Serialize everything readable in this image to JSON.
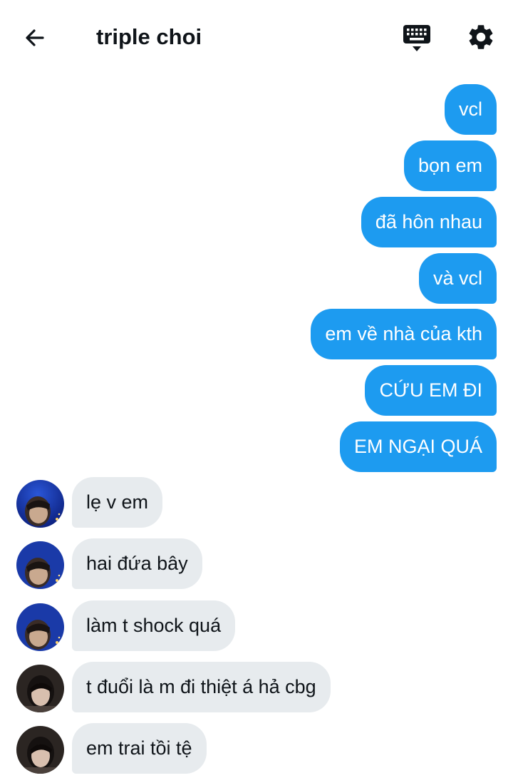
{
  "header": {
    "title": "triple choi",
    "back_icon": "arrow-left-icon",
    "keyboard_icon": "keyboard-icon",
    "settings_icon": "gear-icon"
  },
  "colors": {
    "sent_bubble": "#1d9bf0",
    "received_bubble": "#e7ebee",
    "text": "#0f1419"
  },
  "messages": [
    {
      "direction": "sent",
      "text": "vcl"
    },
    {
      "direction": "sent",
      "text": "bọn em"
    },
    {
      "direction": "sent",
      "text": "đã hôn nhau"
    },
    {
      "direction": "sent",
      "text": "và vcl"
    },
    {
      "direction": "sent",
      "text": "em về nhà của kth"
    },
    {
      "direction": "sent",
      "text": "CỨU EM ĐI"
    },
    {
      "direction": "sent",
      "text": "EM NGẠI QUÁ"
    },
    {
      "direction": "received",
      "text": "lẹ v em",
      "avatar": "avatar-blue-sky"
    },
    {
      "direction": "received",
      "text": "hai đứa bây",
      "avatar": "avatar-blue-sky"
    },
    {
      "direction": "received",
      "text": "làm t shock quá",
      "avatar": "avatar-blue-sky"
    },
    {
      "direction": "received",
      "text": "t đuổi là m đi thiệt á hả cbg",
      "avatar": "avatar-dark"
    },
    {
      "direction": "received",
      "text": "em trai tồi tệ",
      "avatar": "avatar-dark"
    }
  ]
}
